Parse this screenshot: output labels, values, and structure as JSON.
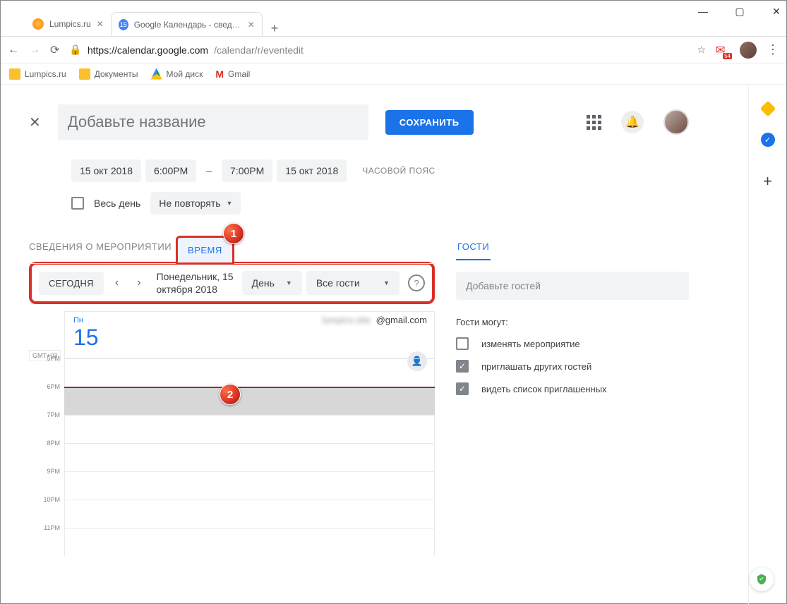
{
  "browser": {
    "tabs": [
      {
        "title": "Lumpics.ru"
      },
      {
        "title": "Google Календарь - сведения о"
      }
    ],
    "url_host": "https://calendar.google.com",
    "url_path": "/calendar/r/eventedit",
    "gmail_badge": "54",
    "bookmarks": [
      "Lumpics.ru",
      "Документы",
      "Мой диск",
      "Gmail"
    ]
  },
  "header": {
    "title_placeholder": "Добавьте название",
    "save": "СОХРАНИТЬ"
  },
  "datetime": {
    "start_date": "15 окт 2018",
    "start_time": "6:00PM",
    "end_time": "7:00PM",
    "end_date": "15 окт 2018",
    "timezone_label": "ЧАСОВОЙ ПОЯС",
    "allday": "Весь день",
    "repeat": "Не повторять"
  },
  "tabs": {
    "details": "СВЕДЕНИЯ О МЕРОПРИЯТИИ",
    "time": "ВРЕМЯ"
  },
  "toolbar": {
    "today": "СЕГОДНЯ",
    "date_line1": "Понедельник, 15",
    "date_line2": "октября 2018",
    "view": "День",
    "guests": "Все гости"
  },
  "schedule": {
    "day_abbr": "Пн",
    "day_num": "15",
    "gmt": "GMT+03",
    "attendee_domain": "@gmail.com",
    "times": [
      "5PM",
      "6PM",
      "7PM",
      "8PM",
      "9PM",
      "10PM",
      "11PM"
    ]
  },
  "guests": {
    "tab": "ГОСТИ",
    "placeholder": "Добавьте гостей",
    "perms_title": "Гости могут:",
    "perm1": "изменять мероприятие",
    "perm2": "приглашать других гостей",
    "perm3": "видеть список приглашенных"
  },
  "callouts": {
    "c1": "1",
    "c2": "2"
  }
}
